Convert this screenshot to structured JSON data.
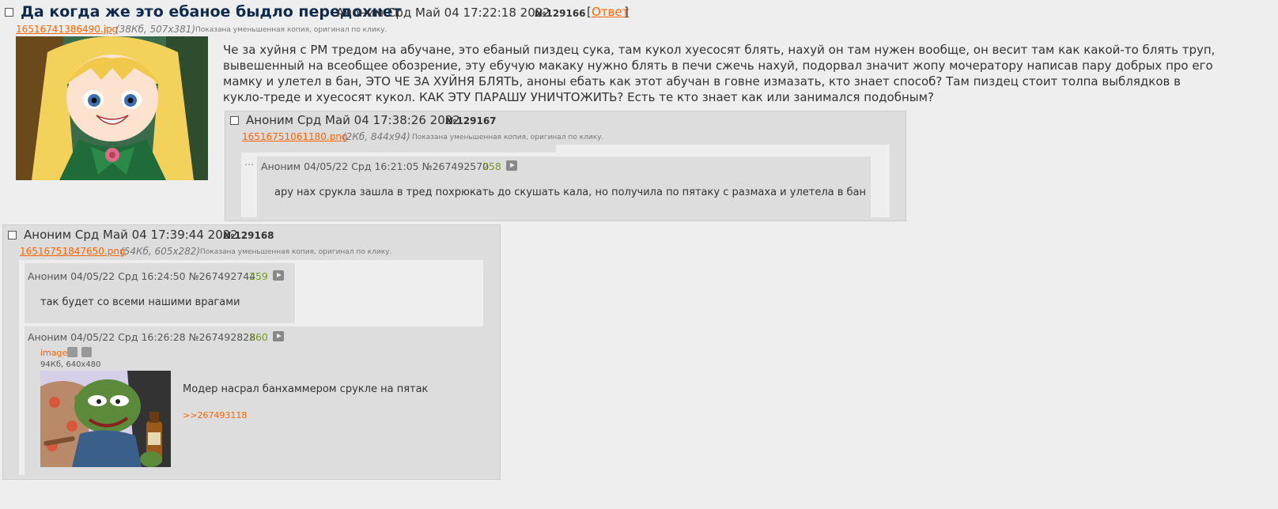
{
  "op": {
    "subject": "Да когда же это ебаное быдло передохнет",
    "author_date": "Аноним Срд Май 04 17:22:18 2022",
    "number": "№129166",
    "reply_link": "Ответ",
    "bracket_open": "[",
    "bracket_close": "]",
    "file_name": "16516741386490.jpg",
    "file_info": "(38Кб, 507x381)",
    "file_note": "Показана уменьшенная копия, оригинал по клику.",
    "message": "Че за хуйня с РМ тредом на абучане, это ебаный пиздец сука, там кукол хуесосят блять, нахуй он там нужен вообще, он весит там как какой-то блять труп, вывешенный на всеобщее обозрение, эту ебучую макаку нужно блять в печи сжечь нахуй, подорвал значит жопу мочератору написав пару добрых про его мамку и улетел в бан, ЭТО ЧЕ ЗА ХУЙНЯ БЛЯТЬ, аноны ебать как этот абучан в говне измазать, кто знает способ? Там пиздец стоит толпа выблядков в кукло-треде и хуесосят кукол. КАК ЭТУ ПАРАШУ УНИЧТОЖИТЬ? Есть те кто знает как или занимался подобным?"
  },
  "reply1": {
    "author_date": "Аноним Срд Май 04 17:38:26 2022",
    "number": "№129167",
    "file_name": "16516751061180.png",
    "file_info": "(2Кб, 844x94)",
    "file_note": "Показана уменьшенная копия, оригинал по клику.",
    "shot": {
      "dots": "...",
      "header": "Аноним 04/05/22 Срд 16:21:05  №267492570",
      "count": "258",
      "text": "ару нах срукла зашла в тред похрюкать до скушать кала, но получила по пятаку с размаха и улетела в бан"
    }
  },
  "reply2": {
    "author_date": "Аноним Срд Май 04 17:39:44 2022",
    "number": "№129168",
    "file_name": "16516751847650.png",
    "file_info": "(54Кб, 605x282)",
    "file_note": "Показана уменьшенная копия, оригинал по клику.",
    "shot_a": {
      "header": "Аноним 04/05/22 Срд 16:24:50  №267492744",
      "count": "259",
      "text": "так будет со всеми нашими врагами"
    },
    "shot_b": {
      "header": "Аноним 04/05/22 Срд 16:26:28  №267492828",
      "count": "260",
      "img_label": "image",
      "img_info": "94Кб, 640x480",
      "text": "Модер насрал банхаммером срукле на пятак",
      "link": ">>267493118"
    }
  },
  "colors": {
    "title": "#0f2b4c",
    "link": "#ff6600",
    "counter": "#789922",
    "background": "#eeeeee",
    "reply_bg": "#dddddd"
  }
}
